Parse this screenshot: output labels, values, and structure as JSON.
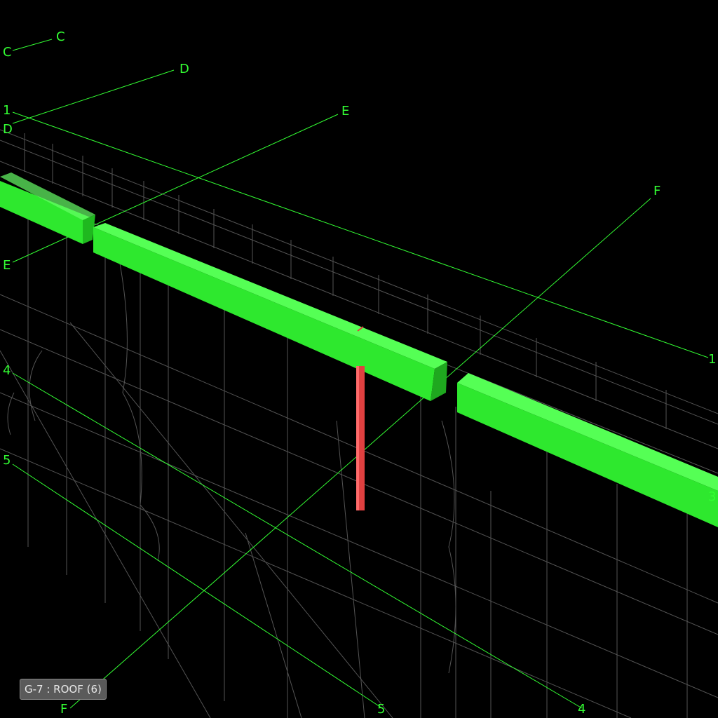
{
  "status_tag": "G-7 : ROOF (6)",
  "grid_labels": {
    "c_top": "C",
    "c_left": "C",
    "d_top": "D",
    "d_left": "D",
    "e_top": "E",
    "e_left": "E",
    "f_top": "F",
    "f_bottom": "F",
    "one_left": "1",
    "one_right": "1",
    "four_left": "4",
    "four_bottom": "4",
    "five_left": "5",
    "five_bottom": "5",
    "three_right": "3"
  },
  "colors": {
    "background": "#000000",
    "grid_line": "#33ff33",
    "beam_highlight": "#33ee33",
    "selected_column": "#e04040",
    "wireframe": "#6a6a6a"
  }
}
